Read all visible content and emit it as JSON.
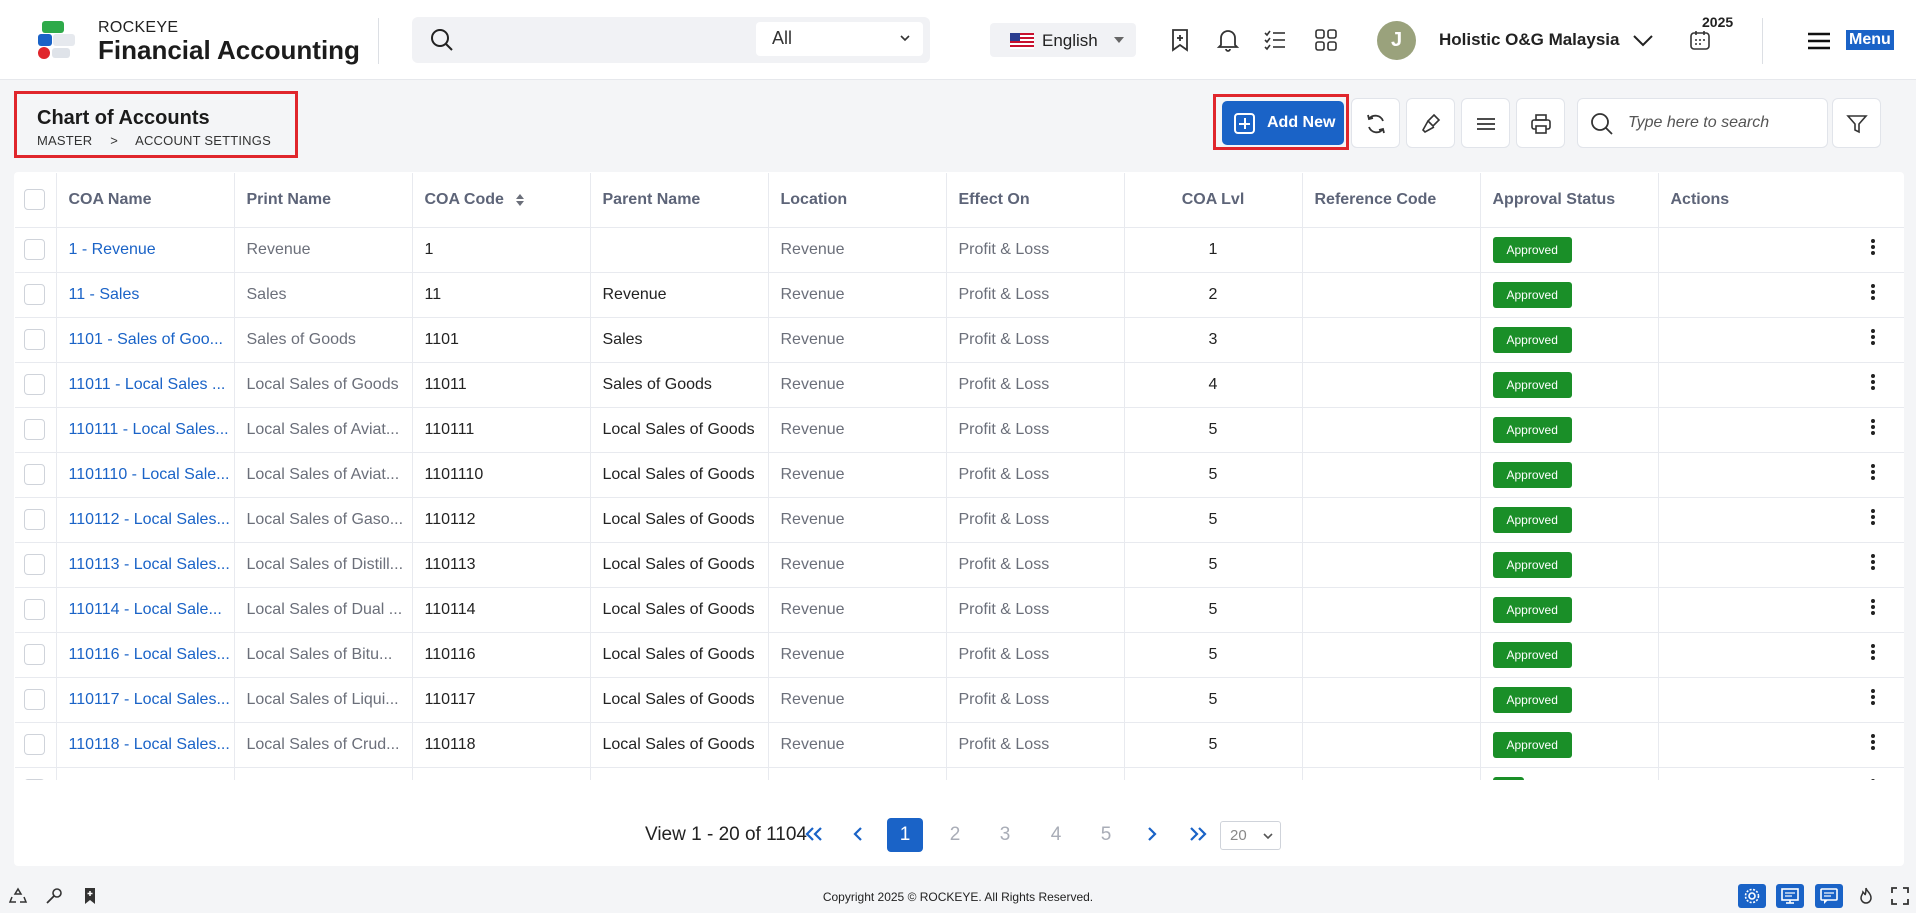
{
  "app": {
    "brand_top": "ROCKEYE",
    "brand_main": "Financial Accounting",
    "search_scope": "All",
    "language": "English",
    "user_initial": "J",
    "company": "Holistic O&G Malaysia",
    "year": "2025",
    "menu_label": "Menu"
  },
  "page": {
    "title": "Chart of Accounts",
    "breadcrumb": [
      "MASTER",
      ">",
      "ACCOUNT SETTINGS"
    ],
    "add_new_label": "Add New",
    "search_placeholder": "Type here to search"
  },
  "table": {
    "columns": [
      "COA Name",
      "Print Name",
      "COA Code",
      "Parent Name",
      "Location",
      "Effect On",
      "COA Lvl",
      "Reference Code",
      "Approval Status",
      "Actions"
    ],
    "rows": [
      {
        "coa_name": "1 - Revenue",
        "print_name": "Revenue",
        "code": "1",
        "parent": "",
        "location": "Revenue",
        "effect": "Profit & Loss",
        "lvl": "1",
        "ref": "",
        "status": "Approved"
      },
      {
        "coa_name": "11 - Sales",
        "print_name": "Sales",
        "code": "11",
        "parent": "Revenue",
        "location": "Revenue",
        "effect": "Profit & Loss",
        "lvl": "2",
        "ref": "",
        "status": "Approved"
      },
      {
        "coa_name": "1101 - Sales of Goo...",
        "print_name": "Sales of Goods",
        "code": "1101",
        "parent": "Sales",
        "location": "Revenue",
        "effect": "Profit & Loss",
        "lvl": "3",
        "ref": "",
        "status": "Approved"
      },
      {
        "coa_name": "11011 - Local Sales ...",
        "print_name": "Local Sales of Goods",
        "code": "11011",
        "parent": "Sales of Goods",
        "location": "Revenue",
        "effect": "Profit & Loss",
        "lvl": "4",
        "ref": "",
        "status": "Approved"
      },
      {
        "coa_name": "110111 - Local Sales...",
        "print_name": "Local Sales of Aviat...",
        "code": "110111",
        "parent": "Local Sales of Goods",
        "location": "Revenue",
        "effect": "Profit & Loss",
        "lvl": "5",
        "ref": "",
        "status": "Approved"
      },
      {
        "coa_name": "1101110 - Local Sale...",
        "print_name": "Local Sales of Aviat...",
        "code": "1101110",
        "parent": "Local Sales of Goods",
        "location": "Revenue",
        "effect": "Profit & Loss",
        "lvl": "5",
        "ref": "",
        "status": "Approved"
      },
      {
        "coa_name": "110112 - Local Sales...",
        "print_name": "Local Sales of Gaso...",
        "code": "110112",
        "parent": "Local Sales of Goods",
        "location": "Revenue",
        "effect": "Profit & Loss",
        "lvl": "5",
        "ref": "",
        "status": "Approved"
      },
      {
        "coa_name": "110113 - Local Sales...",
        "print_name": "Local Sales of Distill...",
        "code": "110113",
        "parent": "Local Sales of Goods",
        "location": "Revenue",
        "effect": "Profit & Loss",
        "lvl": "5",
        "ref": "",
        "status": "Approved"
      },
      {
        "coa_name": "110114 - Local Sale...",
        "print_name": "Local Sales of Dual ...",
        "code": "110114",
        "parent": "Local Sales of Goods",
        "location": "Revenue",
        "effect": "Profit & Loss",
        "lvl": "5",
        "ref": "",
        "status": "Approved"
      },
      {
        "coa_name": "110116 - Local Sales...",
        "print_name": "Local Sales of Bitu...",
        "code": "110116",
        "parent": "Local Sales of Goods",
        "location": "Revenue",
        "effect": "Profit & Loss",
        "lvl": "5",
        "ref": "",
        "status": "Approved"
      },
      {
        "coa_name": "110117 - Local Sales...",
        "print_name": "Local Sales of Liqui...",
        "code": "110117",
        "parent": "Local Sales of Goods",
        "location": "Revenue",
        "effect": "Profit & Loss",
        "lvl": "5",
        "ref": "",
        "status": "Approved"
      },
      {
        "coa_name": "110118 - Local Sales...",
        "print_name": "Local Sales of Crud...",
        "code": "110118",
        "parent": "Local Sales of Goods",
        "location": "Revenue",
        "effect": "Profit & Loss",
        "lvl": "5",
        "ref": "",
        "status": "Approved"
      }
    ]
  },
  "pagination": {
    "view_text": "View 1 - 20 of 1104",
    "pages": [
      "1",
      "2",
      "3",
      "4",
      "5"
    ],
    "active_page": "1",
    "page_size": "20"
  },
  "footer": {
    "copyright": "Copyright 2025 © ROCKEYE. All Rights Reserved."
  },
  "colors": {
    "primary": "#1a63c7",
    "approved": "#1a8f28",
    "highlight_border": "#e0262c"
  },
  "icons": [
    "search-icon",
    "chevron-down-icon",
    "bookmark-add-icon",
    "bell-icon",
    "checklist-icon",
    "apps-grid-icon",
    "calendar-icon",
    "hamburger-icon",
    "refresh-icon",
    "brush-icon",
    "lines-icon",
    "print-icon",
    "filter-icon",
    "kebab-icon"
  ]
}
